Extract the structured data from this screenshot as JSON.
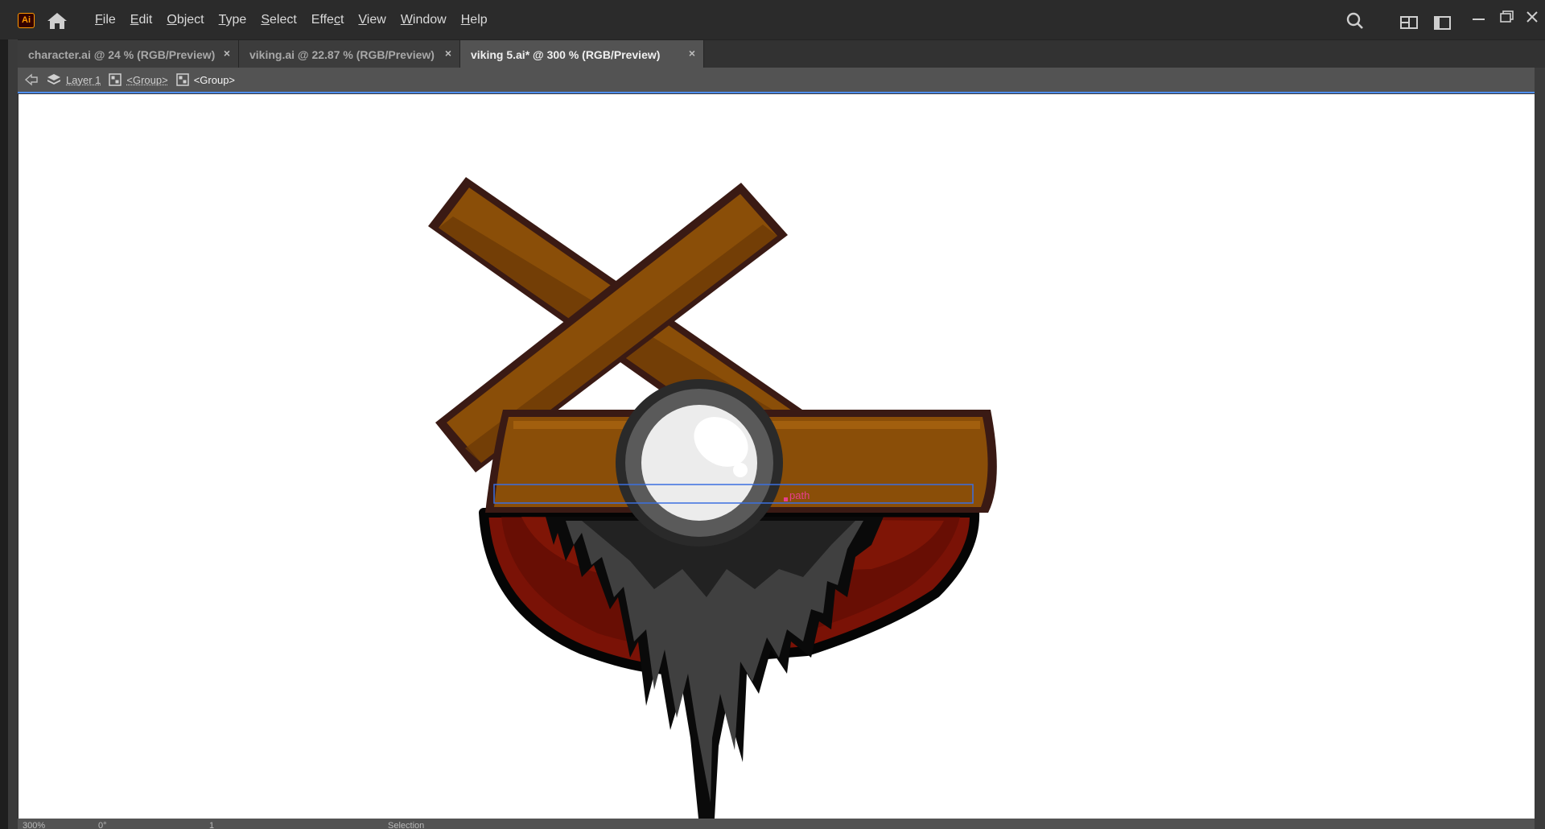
{
  "app": {
    "logo": "Ai"
  },
  "menu": {
    "items": [
      {
        "pre": "",
        "ul": "F",
        "post": "ile"
      },
      {
        "pre": "",
        "ul": "E",
        "post": "dit"
      },
      {
        "pre": "",
        "ul": "O",
        "post": "bject"
      },
      {
        "pre": "",
        "ul": "T",
        "post": "ype"
      },
      {
        "pre": "",
        "ul": "S",
        "post": "elect"
      },
      {
        "pre": "Effe",
        "ul": "c",
        "post": "t"
      },
      {
        "pre": "",
        "ul": "V",
        "post": "iew"
      },
      {
        "pre": "",
        "ul": "W",
        "post": "indow"
      },
      {
        "pre": "",
        "ul": "H",
        "post": "elp"
      }
    ]
  },
  "tabs": [
    {
      "label": "character.ai @ 24 % (RGB/Preview)",
      "close": "×",
      "active": false
    },
    {
      "label": "viking.ai @ 22.87 % (RGB/Preview)",
      "close": "×",
      "active": false
    },
    {
      "label": "viking 5.ai* @ 300 % (RGB/Preview)",
      "close": "×",
      "active": true
    }
  ],
  "breadcrumb": {
    "layer": "Layer 1",
    "group1": "<Group>",
    "group2": "<Group>"
  },
  "canvas": {
    "hover_label": "path",
    "colors": {
      "wood": "#8a4e08",
      "wood_dark": "#6b3a05",
      "wood_outline": "#3a1a14",
      "red": "#7a1206",
      "beard": "#3f3f3f",
      "beard_dark": "#222222",
      "highlight_blue": "#3b6fe0",
      "label_magenta": "#e83e8c"
    }
  },
  "statusbar": {
    "zoom": "300%",
    "rotation": "0°",
    "artboard": "1",
    "tool": "Selection"
  },
  "icons": [
    "home-icon",
    "search-icon",
    "arrange-documents-icon",
    "workspace-icon",
    "minimize-icon",
    "restore-icon",
    "close-icon",
    "back-arrow-icon",
    "layers-icon",
    "group-icon"
  ]
}
